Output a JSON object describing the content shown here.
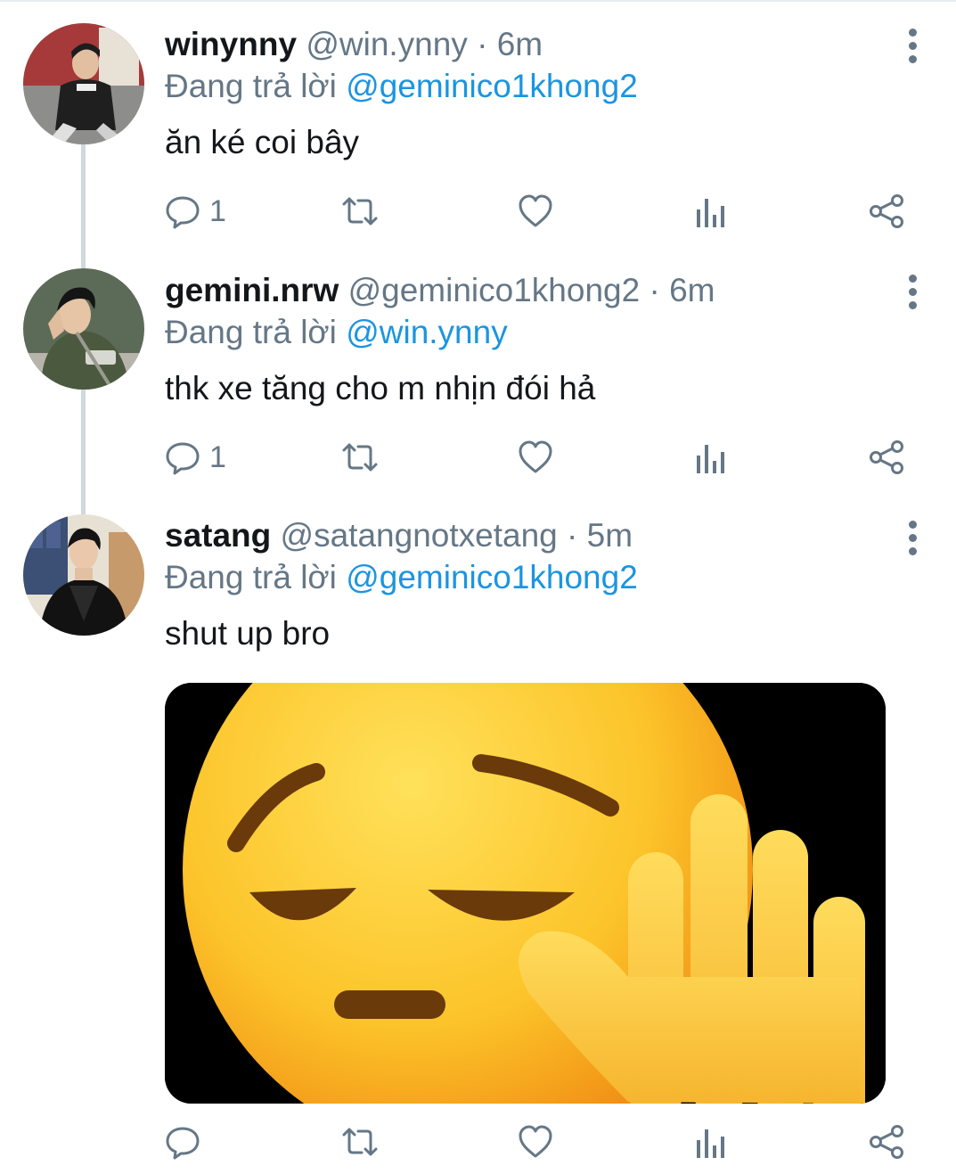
{
  "tweets": [
    {
      "display_name": "winynny",
      "handle": "@win.ynny",
      "separator": "·",
      "time": "6m",
      "replying_prefix": "Đang trả lời",
      "replying_to": "@geminico1khong2",
      "text": "ăn ké coi bây",
      "reply_count": "1"
    },
    {
      "display_name": "gemini.nrw",
      "handle": "@geminico1khong2",
      "separator": "·",
      "time": "6m",
      "replying_prefix": "Đang trả lời",
      "replying_to": "@win.ynny",
      "text": "thk xe tăng cho m nhịn đói hả",
      "reply_count": "1"
    },
    {
      "display_name": "satang",
      "handle": "@satangnotxetang",
      "separator": "·",
      "time": "5m",
      "replying_prefix": "Đang trả lời",
      "replying_to": "@geminico1khong2",
      "text": "shut up bro",
      "reply_count": "",
      "media": "pensive-face-raised-hand-emoji"
    }
  ],
  "icons": [
    "reply-icon",
    "retweet-icon",
    "like-icon",
    "analytics-icon",
    "share-icon",
    "more-options-icon"
  ],
  "colors": {
    "accent": "#1b95e0",
    "secondary_text": "#657786",
    "primary_text": "#14171a",
    "thread_line": "#cfd9de"
  }
}
